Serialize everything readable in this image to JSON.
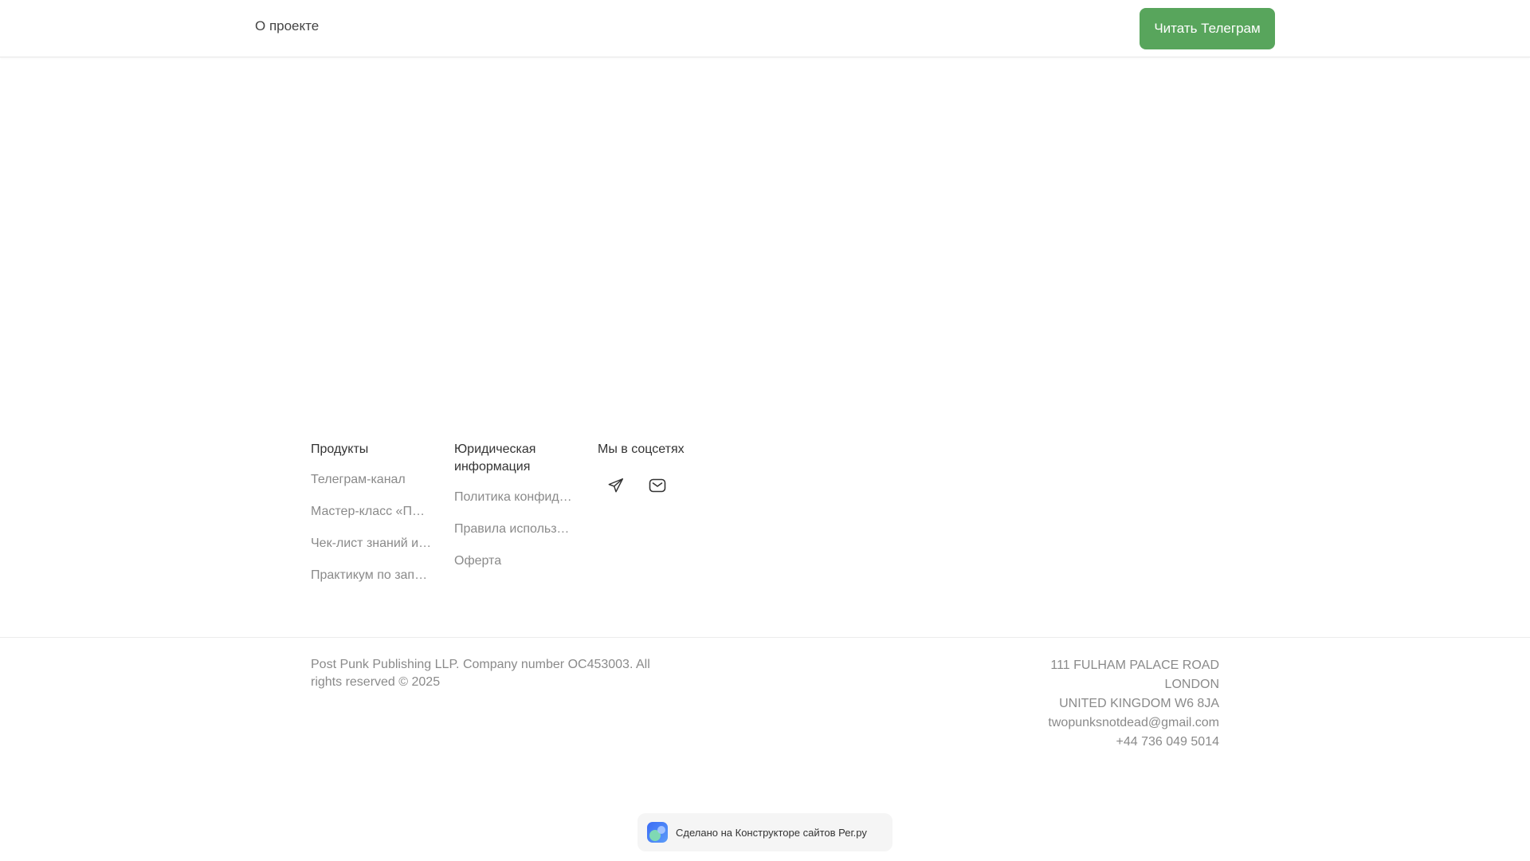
{
  "header": {
    "nav_about": "О проекте",
    "cta_label": "Читать Телеграм",
    "cta_color": "#58a55c"
  },
  "footer": {
    "products": {
      "heading": "Продукты",
      "items": [
        "Телеграм-канал",
        "Мастер-класс «Пл…",
        "Чек-лист знаний и…",
        "Практикум по запу…"
      ]
    },
    "legal": {
      "heading": "Юридическая информация",
      "items": [
        "Политика конфиде…",
        "Правила использов…",
        "Оферта"
      ]
    },
    "social": {
      "heading": "Мы в соцсетях",
      "icons": [
        "telegram-icon",
        "mail-icon"
      ]
    },
    "copyright": "Post Punk Publishing LLP. Company number OC453003. All rights reserved © 2025",
    "contact": {
      "address_line1": "111 FULHAM PALACE ROAD",
      "address_line2": "LONDON",
      "address_line3": "UNITED KINGDOM W6 8JA",
      "email": "twopunksnotdead@gmail.com",
      "phone": "+44 736 049 5014"
    }
  },
  "badge": {
    "text": "Сделано на Конструкторе сайтов Рег.ру"
  }
}
